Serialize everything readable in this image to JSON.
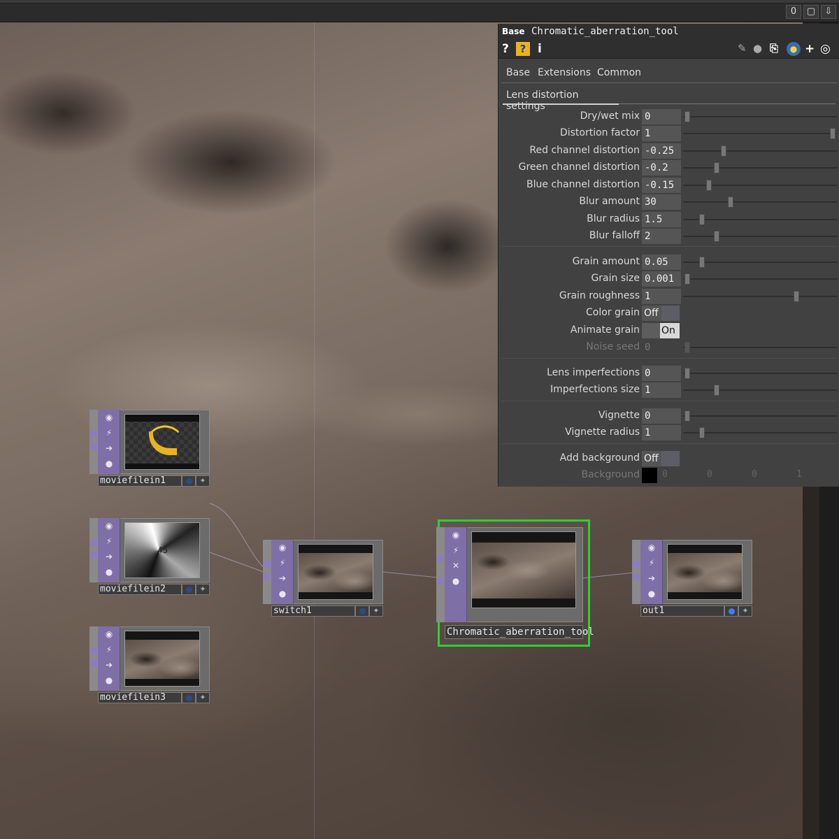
{
  "topbar": {
    "counter": "0",
    "maximize_icon": "window-icon",
    "down_icon": "down-arrow-icon"
  },
  "panel": {
    "op_type": "Base",
    "op_name": "Chromatic_aberration_tool",
    "tabs": [
      "Base",
      "Extensions",
      "Common"
    ],
    "page": "Lens distortion settings",
    "params": [
      {
        "label": "Dry/wet mix",
        "value": "0",
        "slider": 0.0
      },
      {
        "label": "Distortion factor",
        "value": "1",
        "slider": 1.0
      },
      {
        "label": "Red channel distortion",
        "value": "-0.25",
        "slider": 0.25
      },
      {
        "label": "Green channel distortion",
        "value": "-0.2",
        "slider": 0.2
      },
      {
        "label": "Blue channel distortion",
        "value": "-0.15",
        "slider": 0.15
      },
      {
        "label": "Blur amount",
        "value": "30",
        "slider": 0.3
      },
      {
        "label": "Blur radius",
        "value": "1.5",
        "slider": 0.1
      },
      {
        "label": "Blur falloff",
        "value": "2",
        "slider": 0.2
      },
      {
        "label": "Grain amount",
        "value": "0.05",
        "slider": 0.1
      },
      {
        "label": "Grain size",
        "value": "0.001",
        "slider": 0.0
      },
      {
        "label": "Grain roughness",
        "value": "1",
        "slider": 0.75
      },
      {
        "label": "Color grain",
        "value": "Off"
      },
      {
        "label": "Animate grain",
        "value": "On"
      },
      {
        "label": "Noise seed",
        "value": "0",
        "slider": 0.0
      },
      {
        "label": "Lens imperfections",
        "value": "0",
        "slider": 0.0
      },
      {
        "label": "Imperfections size",
        "value": "1",
        "slider": 0.2
      },
      {
        "label": "Vignette",
        "value": "0",
        "slider": 0.0
      },
      {
        "label": "Vignette radius",
        "value": "1",
        "slider": 0.1
      },
      {
        "label": "Add background",
        "value": "Off"
      },
      {
        "label": "Background",
        "values": [
          "0",
          "0",
          "0",
          "1"
        ],
        "color": "#000000"
      }
    ]
  },
  "nodes": {
    "moviefilein1": "moviefilein1",
    "moviefilein2": "moviefilein2",
    "moviefilein3": "moviefilein3",
    "switch1": "switch1",
    "chromatic": "Chromatic_aberration_tool",
    "out1": "out1",
    "moviefilein2_overlay": "45"
  },
  "colors": {
    "selection": "#2dd12d",
    "node_side": "#7f6fa7",
    "display_flag": "#3d7dff"
  }
}
